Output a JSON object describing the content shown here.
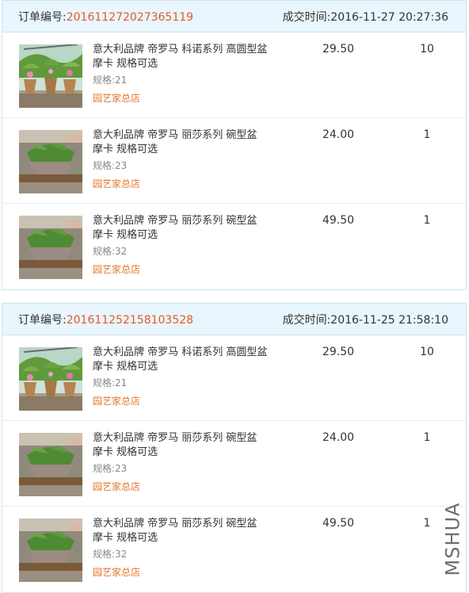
{
  "orders": [
    {
      "order_label": "订单编号:",
      "order_number": "201611272027365119",
      "time_label": "成交时间:",
      "time_value": "2016-11-27 20:27:36",
      "items": [
        {
          "name": "意大利品牌 帝罗马 科诺系列 高圆型盆 摩卡 规格可选",
          "spec": "规格:21",
          "shop": "园艺家总店",
          "price": "29.50",
          "qty": "10",
          "image": "tall-pots-photo"
        },
        {
          "name": "意大利品牌 帝罗马 丽莎系列 碗型盆 摩卡 规格可选",
          "spec": "规格:23",
          "shop": "园艺家总店",
          "price": "24.00",
          "qty": "1",
          "image": "bowl-pot-photo"
        },
        {
          "name": "意大利品牌 帝罗马 丽莎系列 碗型盆 摩卡 规格可选",
          "spec": "规格:32",
          "shop": "园艺家总店",
          "price": "49.50",
          "qty": "1",
          "image": "bowl-pot-photo"
        }
      ]
    },
    {
      "order_label": "订单编号:",
      "order_number": "201611252158103528",
      "time_label": "成交时间:",
      "time_value": "2016-11-25 21:58:10",
      "items": [
        {
          "name": "意大利品牌 帝罗马 科诺系列 高圆型盆 摩卡 规格可选",
          "spec": "规格:21",
          "shop": "园艺家总店",
          "price": "29.50",
          "qty": "10",
          "image": "tall-pots-photo"
        },
        {
          "name": "意大利品牌 帝罗马 丽莎系列 碗型盆 摩卡 规格可选",
          "spec": "规格:23",
          "shop": "园艺家总店",
          "price": "24.00",
          "qty": "1",
          "image": "bowl-pot-photo"
        },
        {
          "name": "意大利品牌 帝罗马 丽莎系列 碗型盆 摩卡 规格可选",
          "spec": "规格:32",
          "shop": "园艺家总店",
          "price": "49.50",
          "qty": "1",
          "image": "bowl-pot-photo"
        }
      ]
    }
  ],
  "watermark": "MSHUA",
  "colors": {
    "order_number": "#e65a2a",
    "shop": "#e6762a",
    "header_bg": "#e9f6fd",
    "border": "#cfe3ee"
  }
}
